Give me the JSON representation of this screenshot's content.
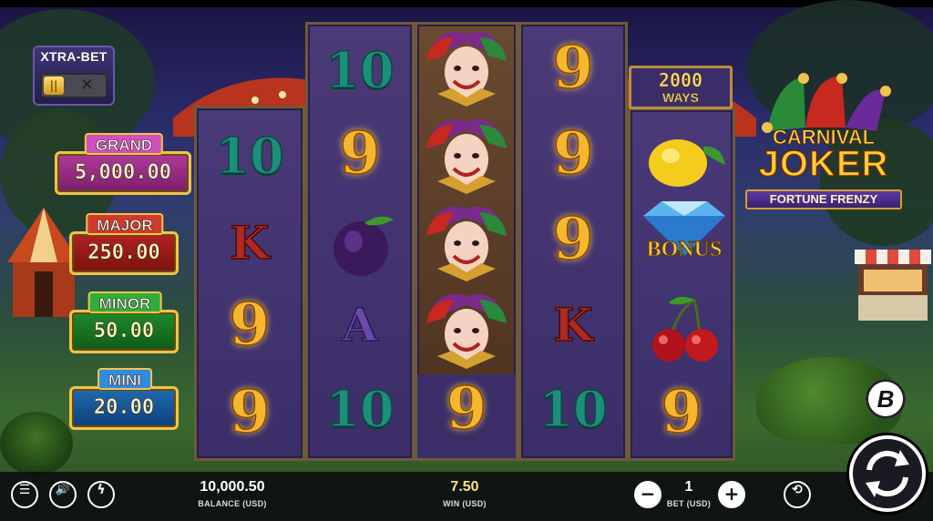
{
  "game": {
    "logo_line1": "CARNIVAL",
    "logo_line2": "JOKER",
    "logo_line3": "FORTUNE FRENZY",
    "ways_count": "2000",
    "ways_label": "WAYS"
  },
  "xtra_bet": {
    "label": "XTRA-BET",
    "toggle_on_icon": "pause-bars-icon",
    "toggle_off_icon": "x-icon"
  },
  "jackpots": [
    {
      "name": "GRAND",
      "value": "5,000.00",
      "color": "#b03a9a",
      "title_color": "#d34fbf"
    },
    {
      "name": "MAJOR",
      "value": "250.00",
      "color": "#b0221e",
      "title_color": "#d03a2a"
    },
    {
      "name": "MINOR",
      "value": "50.00",
      "color": "#1f8a2a",
      "title_color": "#2fae3a"
    },
    {
      "name": "MINI",
      "value": "20.00",
      "color": "#1f6ab0",
      "title_color": "#2f8ae0"
    }
  ],
  "reels": [
    [
      "10",
      "K",
      "9",
      "9"
    ],
    [
      "10",
      "9",
      "plum",
      "A",
      "10"
    ],
    [
      "joker",
      "joker",
      "joker",
      "joker",
      "9"
    ],
    [
      "9",
      "9",
      "9",
      "K",
      "10"
    ],
    [
      "lemon",
      "diamond",
      "cherries",
      "9"
    ]
  ],
  "bonus_label": "BONUS",
  "bottom_bar": {
    "balance_value": "10,000.50",
    "balance_label": "BALANCE (USD)",
    "win_value": "7.50",
    "win_label": "WIN (USD)",
    "bet_value": "1",
    "bet_label": "BET (USD)",
    "minus": "−",
    "plus": "+"
  },
  "colors": {
    "accent_gold": "#f0c44a",
    "win_color": "#ffe27a"
  }
}
